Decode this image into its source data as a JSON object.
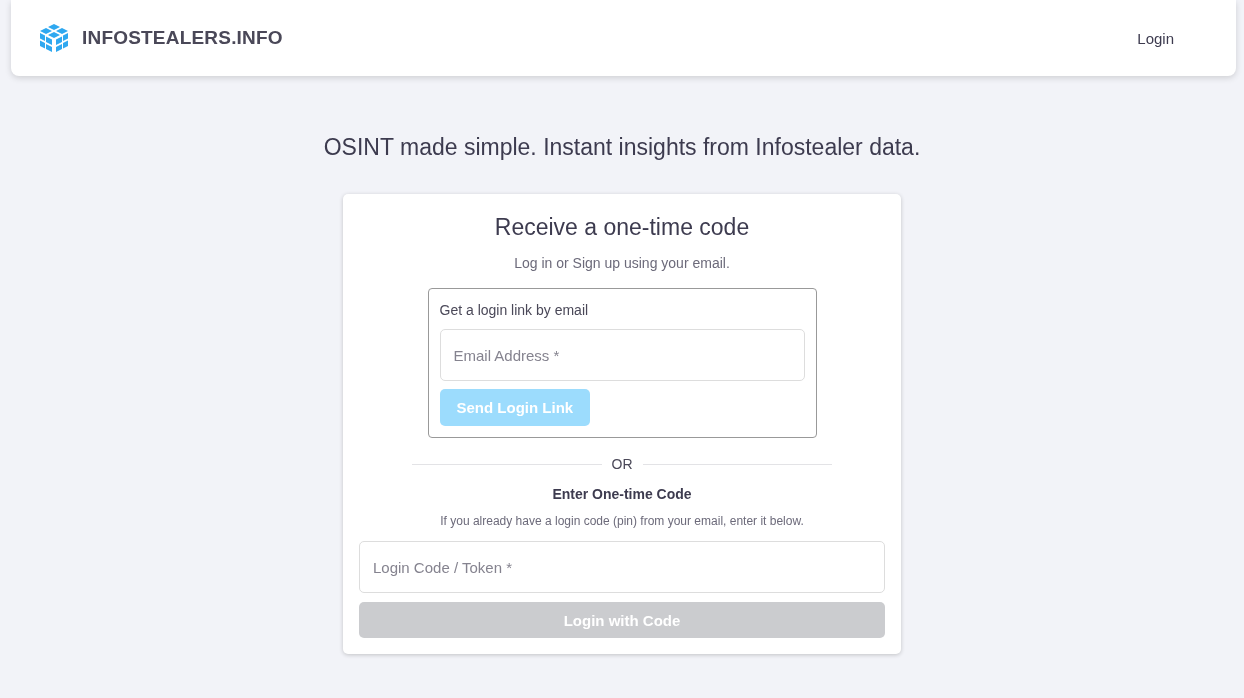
{
  "header": {
    "brand": "INFOSTEALERS.INFO",
    "nav_link": "Login"
  },
  "tagline": "OSINT made simple. Instant insights from Infostealer data.",
  "card": {
    "title": "Receive a one-time code",
    "subtitle": "Log in or Sign up using your email.",
    "email_section": {
      "heading": "Get a login link by email",
      "field": {
        "placeholder": "Email Address *"
      },
      "button": {
        "label": "Send Login Link",
        "disabled": true
      }
    },
    "divider": "OR",
    "code_section": {
      "heading": "Enter One-time Code",
      "hint": "If you already have a login code (pin) from your email, enter it below.",
      "field": {
        "placeholder": "Login Code / Token *"
      },
      "button": {
        "label": "Login with Code",
        "disabled": true
      }
    }
  }
}
